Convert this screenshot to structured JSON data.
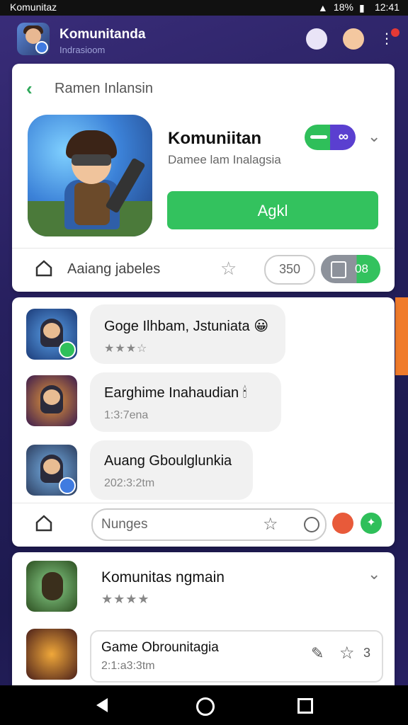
{
  "status_bar": {
    "app_label": "Komunitaz",
    "battery": "18%",
    "time": "12:41"
  },
  "app_bar": {
    "title": "Komunitanda",
    "subtitle": "Indrasioom"
  },
  "header_card": {
    "breadcrumb": "Ramen Inlansin",
    "title": "Komuniitan",
    "subtitle": "Damee lam Inalagsia",
    "primary_button": "Agkl",
    "row_label": "Aaiang jabeles",
    "count_pill": "350",
    "badge_pill": "08"
  },
  "conversation": [
    {
      "title": "Goge Ilhbam, Jstuniata",
      "emoji": "😀",
      "stars": "★★★☆"
    },
    {
      "title": "Earghime Inahaudian",
      "emoji": "🕯",
      "subtitle": "1:3:7ena"
    },
    {
      "title": "Auang Gboulglunkia",
      "subtitle": "202:3:2tm"
    }
  ],
  "composer": {
    "placeholder": "Nunges"
  },
  "group_card": {
    "title": "Komunitas ngmain",
    "stars": "★★★★",
    "sub_item": {
      "title": "Game Obrounitagia",
      "subtitle": "2:1:a3:3tm",
      "count": "3"
    }
  },
  "colors": {
    "accent_green": "#33c25e",
    "purple_bg": "#27205f",
    "orange_accent": "#f07b2b"
  }
}
